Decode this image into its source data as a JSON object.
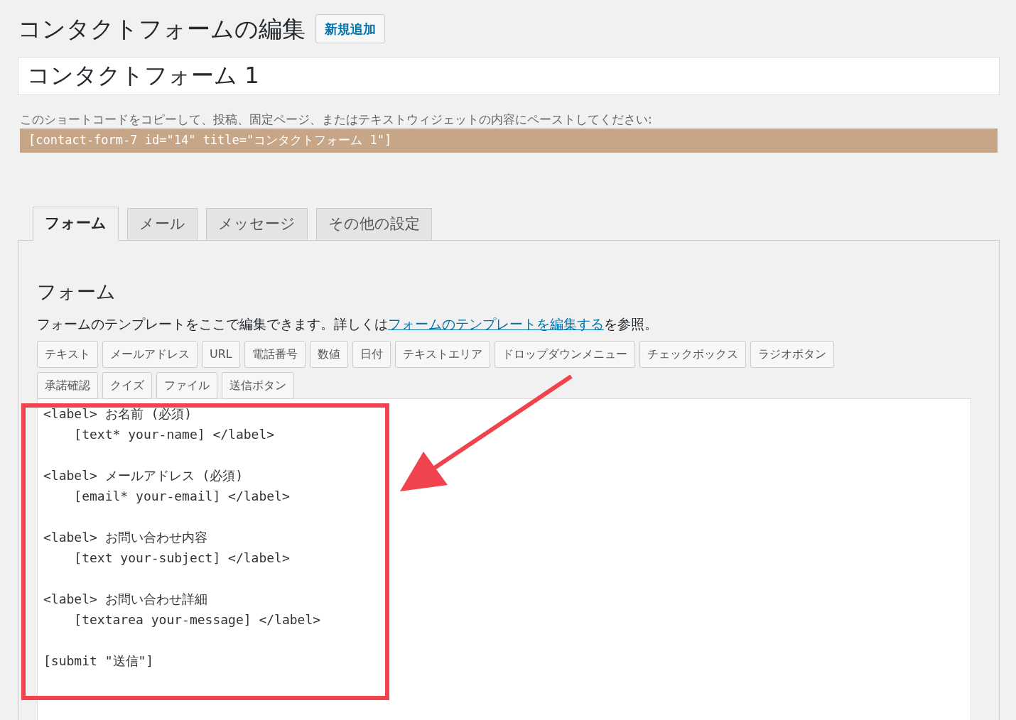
{
  "page_title": "コンタクトフォームの編集",
  "add_new_button": "新規追加",
  "form_title_value": "コンタクトフォーム 1",
  "shortcode_hint": "このショートコードをコピーして、投稿、固定ページ、またはテキストウィジェットの内容にペーストしてください:",
  "shortcode": "[contact-form-7 id=\"14\" title=\"コンタクトフォーム 1\"]",
  "tabs": [
    {
      "label": "フォーム",
      "selected": true
    },
    {
      "label": "メール",
      "selected": false
    },
    {
      "label": "メッセージ",
      "selected": false
    },
    {
      "label": "その他の設定",
      "selected": false
    }
  ],
  "panel": {
    "heading": "フォーム",
    "description": {
      "before": "フォームのテンプレートをここで編集できます。詳しくは",
      "link": "フォームのテンプレートを編集する",
      "after": "を参照。"
    },
    "tag_button_rows": [
      [
        "テキスト",
        "メールアドレス",
        "URL",
        "電話番号",
        "数値",
        "日付",
        "テキストエリア",
        "ドロップダウンメニュー",
        "チェックボックス",
        "ラジオボタン"
      ],
      [
        "承諾確認",
        "クイズ",
        "ファイル",
        "送信ボタン"
      ]
    ],
    "template": "<label> お名前 (必須)\n    [text* your-name] </label>\n\n<label> メールアドレス (必須)\n    [email* your-email] </label>\n\n<label> お問い合わせ内容\n    [text your-subject] </label>\n\n<label> お問い合わせ詳細\n    [textarea your-message] </label>\n\n[submit \"送信\"]"
  }
}
